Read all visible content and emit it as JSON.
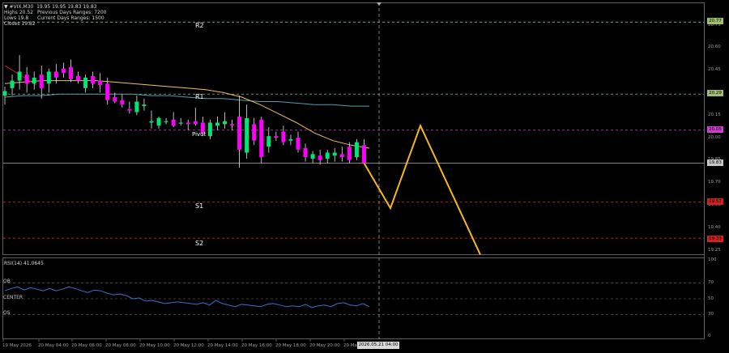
{
  "symbol_line": "▼ #VIX,M30  19.95 19.95 19.83 19.83",
  "info": {
    "highs": "Highs 20.52",
    "prev_range": "Previous Days Ranges: 7200",
    "lows": "Lows 19.8",
    "curr_range": "Current Days Ranges: 1500",
    "close": "Closes 19.82"
  },
  "levels": {
    "r2": "R2",
    "r1": "R1",
    "pivot": "Pivot",
    "s1": "S1",
    "s2": "S2"
  },
  "price_tags": {
    "r2": "20.77",
    "r1": "20.29",
    "pivot": "20.05",
    "current": "19.83",
    "s1": "19.57",
    "s2": "19.33"
  },
  "price_axis": [
    "20.75",
    "20.60",
    "20.45",
    "20.30",
    "20.15",
    "20.00",
    "19.85",
    "19.70",
    "19.55",
    "19.40",
    "19.25"
  ],
  "rsi": {
    "title": "RSI(14) 41.0645",
    "ob": "OB",
    "center": "CENTER",
    "os": "OS",
    "axis": [
      "100",
      "70",
      "50",
      "30",
      "0"
    ]
  },
  "time_axis": [
    "19 May 2026",
    "20 May 04:00",
    "20 May 06:00",
    "20 May 08:00",
    "20 May 10:00",
    "20 May 12:00",
    "20 May 14:00",
    "20 May 16:00",
    "20 May 18:00",
    "20 May 20:00",
    "20 Ma"
  ],
  "time_highlight": "2026.05.21 04:00",
  "colors": {
    "bull": "#00e676",
    "bear": "#ff00ff",
    "r_line": "#80c080",
    "s_line": "#d02020",
    "pivot_line": "#d040d0",
    "projection": "#f5b820",
    "ma_fast": "#f0c060",
    "ma_slow": "#50a0b0",
    "rsi_line": "#3f6fcf"
  },
  "chart_data": {
    "type": "candlestick",
    "timeframe": "M30",
    "price_range": [
      19.2,
      20.85
    ],
    "candles": [
      {
        "o": 20.28,
        "h": 20.34,
        "l": 20.22,
        "c": 20.31
      },
      {
        "o": 20.33,
        "h": 20.42,
        "l": 20.28,
        "c": 20.38
      },
      {
        "o": 20.38,
        "h": 20.55,
        "l": 20.32,
        "c": 20.44
      },
      {
        "o": 20.42,
        "h": 20.47,
        "l": 20.3,
        "c": 20.36
      },
      {
        "o": 20.36,
        "h": 20.44,
        "l": 20.32,
        "c": 20.4
      },
      {
        "o": 20.42,
        "h": 20.48,
        "l": 20.26,
        "c": 20.33
      },
      {
        "o": 20.36,
        "h": 20.46,
        "l": 20.3,
        "c": 20.44
      },
      {
        "o": 20.44,
        "h": 20.49,
        "l": 20.36,
        "c": 20.4
      },
      {
        "o": 20.46,
        "h": 20.5,
        "l": 20.4,
        "c": 20.43
      },
      {
        "o": 20.47,
        "h": 20.52,
        "l": 20.37,
        "c": 20.39
      },
      {
        "o": 20.41,
        "h": 20.44,
        "l": 20.36,
        "c": 20.38
      },
      {
        "o": 20.33,
        "h": 20.42,
        "l": 20.3,
        "c": 20.4
      },
      {
        "o": 20.41,
        "h": 20.44,
        "l": 20.33,
        "c": 20.36
      },
      {
        "o": 20.38,
        "h": 20.43,
        "l": 20.3,
        "c": 20.35
      },
      {
        "o": 20.36,
        "h": 20.4,
        "l": 20.22,
        "c": 20.25
      },
      {
        "o": 20.27,
        "h": 20.3,
        "l": 20.23,
        "c": 20.24
      },
      {
        "o": 20.25,
        "h": 20.29,
        "l": 20.2,
        "c": 20.22
      },
      {
        "o": 20.19,
        "h": 20.24,
        "l": 20.16,
        "c": 20.18
      },
      {
        "o": 20.17,
        "h": 20.28,
        "l": 20.15,
        "c": 20.24
      },
      {
        "o": 20.21,
        "h": 20.26,
        "l": 20.18,
        "c": 20.22
      },
      {
        "o": 20.1,
        "h": 20.18,
        "l": 20.06,
        "c": 20.11
      },
      {
        "o": 20.08,
        "h": 20.14,
        "l": 20.06,
        "c": 20.13
      },
      {
        "o": 20.11,
        "h": 20.13,
        "l": 20.09,
        "c": 20.11
      },
      {
        "o": 20.12,
        "h": 20.17,
        "l": 20.07,
        "c": 20.08
      },
      {
        "o": 20.1,
        "h": 20.13,
        "l": 20.08,
        "c": 20.1
      },
      {
        "o": 20.1,
        "h": 20.12,
        "l": 20.05,
        "c": 20.09
      },
      {
        "o": 20.11,
        "h": 20.2,
        "l": 20.08,
        "c": 20.09
      },
      {
        "o": 20.1,
        "h": 20.14,
        "l": 20.01,
        "c": 20.03
      },
      {
        "o": 20.01,
        "h": 20.12,
        "l": 19.99,
        "c": 20.1
      },
      {
        "o": 20.08,
        "h": 20.14,
        "l": 20.05,
        "c": 20.1
      },
      {
        "o": 20.09,
        "h": 20.17,
        "l": 20.06,
        "c": 20.11
      },
      {
        "o": 20.09,
        "h": 20.12,
        "l": 20.05,
        "c": 20.08
      },
      {
        "o": 20.14,
        "h": 20.28,
        "l": 19.8,
        "c": 19.92
      },
      {
        "o": 19.9,
        "h": 20.22,
        "l": 19.86,
        "c": 20.13
      },
      {
        "o": 20.09,
        "h": 20.13,
        "l": 19.95,
        "c": 19.98
      },
      {
        "o": 20.12,
        "h": 20.14,
        "l": 19.83,
        "c": 19.87
      },
      {
        "o": 19.94,
        "h": 20.07,
        "l": 19.9,
        "c": 20.01
      },
      {
        "o": 20.01,
        "h": 20.04,
        "l": 19.98,
        "c": 20.0
      },
      {
        "o": 20.04,
        "h": 20.08,
        "l": 19.95,
        "c": 19.97
      },
      {
        "o": 19.98,
        "h": 20.02,
        "l": 19.95,
        "c": 19.99
      },
      {
        "o": 20.0,
        "h": 20.04,
        "l": 19.9,
        "c": 19.92
      },
      {
        "o": 19.93,
        "h": 19.96,
        "l": 19.84,
        "c": 19.87
      },
      {
        "o": 19.86,
        "h": 19.91,
        "l": 19.83,
        "c": 19.89
      },
      {
        "o": 19.88,
        "h": 19.92,
        "l": 19.82,
        "c": 19.85
      },
      {
        "o": 19.86,
        "h": 19.92,
        "l": 19.83,
        "c": 19.9
      },
      {
        "o": 19.88,
        "h": 19.93,
        "l": 19.84,
        "c": 19.9
      },
      {
        "o": 19.89,
        "h": 19.94,
        "l": 19.84,
        "c": 19.87
      },
      {
        "o": 19.94,
        "h": 19.97,
        "l": 19.83,
        "c": 19.85
      },
      {
        "o": 19.87,
        "h": 19.99,
        "l": 19.85,
        "c": 19.97
      },
      {
        "o": 19.95,
        "h": 19.99,
        "l": 19.83,
        "c": 19.83
      }
    ],
    "ma_fast": [
      20.36,
      20.37,
      20.38,
      20.38,
      20.38,
      20.38,
      20.37,
      20.36,
      20.35,
      20.34,
      20.33,
      20.32,
      20.3,
      20.27,
      20.22,
      20.16,
      20.1,
      20.03,
      19.98,
      19.95,
      19.93
    ],
    "ma_slow": [
      20.27,
      20.28,
      20.28,
      20.29,
      20.29,
      20.29,
      20.29,
      20.29,
      20.28,
      20.28,
      20.27,
      20.26,
      20.26,
      20.25,
      20.24,
      20.24,
      20.23,
      20.22,
      20.22,
      20.21,
      20.21
    ],
    "trend_line": [
      20.48,
      20.35
    ],
    "projection": [
      19.83,
      19.53,
      20.08,
      19.22
    ],
    "pivots": {
      "r2": 20.77,
      "r1": 20.29,
      "pivot": 20.05,
      "s1": 19.57,
      "s2": 19.33,
      "current": 19.83
    },
    "rsi_values": [
      60,
      63,
      65,
      61,
      64,
      62,
      60,
      63,
      60,
      62,
      65,
      63,
      60,
      58,
      61,
      60,
      57,
      55,
      56,
      54,
      50,
      51,
      47,
      48,
      46,
      44,
      45,
      46,
      45,
      44,
      43,
      45,
      42,
      48,
      44,
      42,
      40,
      43,
      42,
      41,
      40,
      43,
      44,
      42,
      40,
      41,
      40,
      43,
      39,
      41,
      42,
      40,
      44,
      45,
      42,
      41,
      44,
      40
    ],
    "rsi_range": [
      0,
      100
    ]
  }
}
